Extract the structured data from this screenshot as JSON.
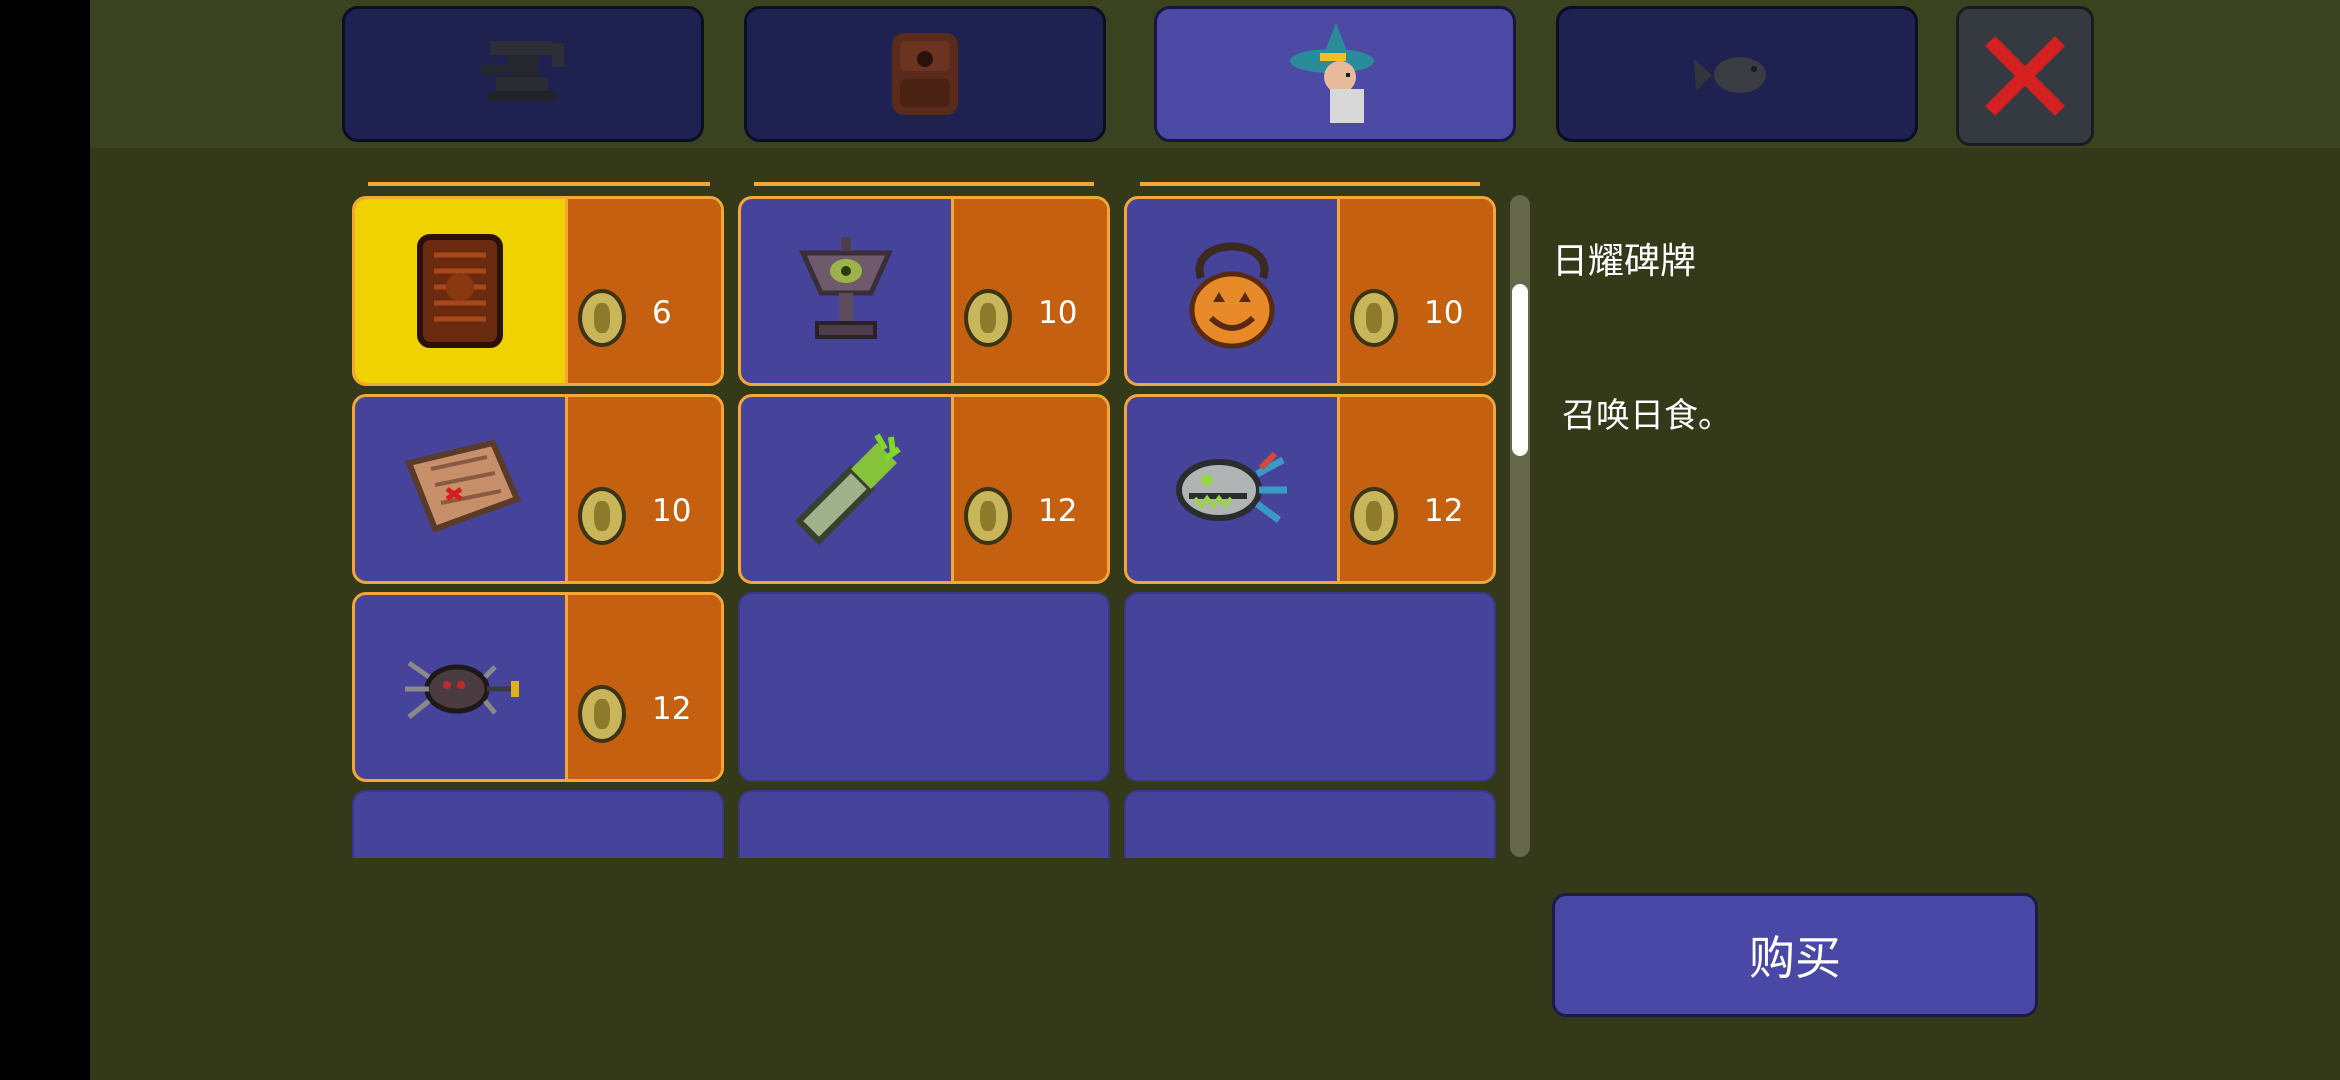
{
  "tabs": [
    {
      "icon": "anvil-icon",
      "active": false
    },
    {
      "icon": "backpack-icon",
      "active": false
    },
    {
      "icon": "wizard-npc-icon",
      "active": true
    },
    {
      "icon": "fish-icon",
      "active": false
    }
  ],
  "close_icon": "close-x-icon",
  "shop": {
    "items": [
      {
        "icon": "solar-tablet-icon",
        "price": "6",
        "selected": true
      },
      {
        "icon": "trophy-icon",
        "price": "10",
        "selected": false
      },
      {
        "icon": "pumpkin-medallion-icon",
        "price": "10",
        "selected": false
      },
      {
        "icon": "map-scroll-icon",
        "price": "10",
        "selected": false
      },
      {
        "icon": "green-bottle-icon",
        "price": "12",
        "selected": false
      },
      {
        "icon": "skull-fish-icon",
        "price": "12",
        "selected": false
      },
      {
        "icon": "mechanical-spider-icon",
        "price": "12",
        "selected": false
      }
    ]
  },
  "detail": {
    "name": "日耀碑牌",
    "description": "召唤日食。"
  },
  "buy_label": "购买",
  "colors": {
    "background": "#34391a",
    "slot": "#46439a",
    "price_pane": "#c4600f",
    "border": "#f4a636",
    "selected": "#f0d200"
  }
}
